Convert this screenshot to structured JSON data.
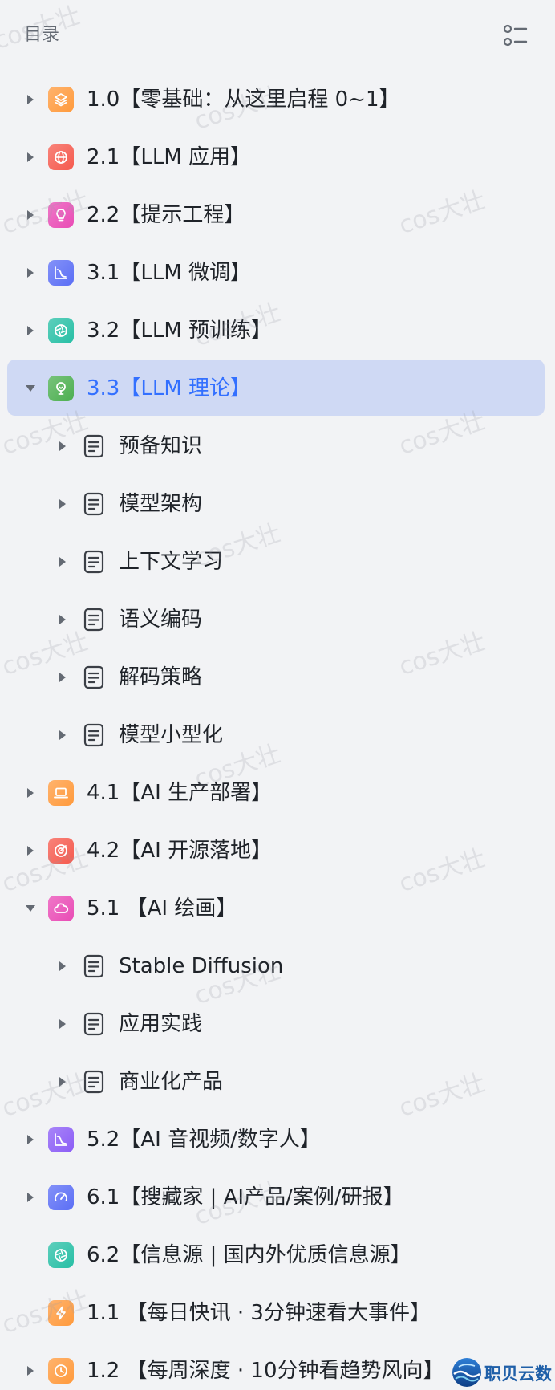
{
  "header": {
    "title": "目录",
    "toggle_icon": "outline-list-icon"
  },
  "watermark": "cos大壮",
  "colors": {
    "background": "#f2f3f5",
    "active_bg": "#cfd9f4",
    "active_text": "#3370ff",
    "text": "#1f2329",
    "muted": "#646a73"
  },
  "items": [
    {
      "label": "1.0【零基础：从这里启程 0~1】",
      "icon": "layers-icon",
      "color": "#ff9a3c",
      "expanded": false
    },
    {
      "label": "2.1【LLM 应用】",
      "icon": "globe-icon",
      "color": "#f55a4e",
      "expanded": false
    },
    {
      "label": "2.2【提示工程】",
      "icon": "lightbulb-icon",
      "color": "#e94bb5",
      "expanded": false
    },
    {
      "label": "3.1【LLM 微调】",
      "icon": "chart-icon",
      "color": "#5b6ef5",
      "expanded": false
    },
    {
      "label": "3.2【LLM 预训练】",
      "icon": "aperture-icon",
      "color": "#27bfa5",
      "expanded": false
    },
    {
      "label": "3.3【LLM 理论】",
      "icon": "bulb-idea-icon",
      "color": "#4caf50",
      "expanded": true,
      "active": true,
      "children": [
        "预备知识",
        "模型架构",
        "上下文学习",
        "语义编码",
        "解码策略",
        "模型小型化"
      ]
    },
    {
      "label": "4.1【AI 生产部署】",
      "icon": "laptop-icon",
      "color": "#ff9a3c",
      "expanded": false
    },
    {
      "label": "4.2【AI 开源落地】",
      "icon": "target-icon",
      "color": "#f55a4e",
      "expanded": false
    },
    {
      "label": "5.1 【AI 绘画】",
      "icon": "cloud-icon",
      "color": "#e94bb5",
      "expanded": true,
      "children": [
        "Stable Diffusion",
        "应用实践",
        "商业化产品"
      ]
    },
    {
      "label": "5.2【AI 音视频/数字人】",
      "icon": "chart-icon",
      "color": "#8b5cf6",
      "expanded": false
    },
    {
      "label": "6.1【搜藏家 | AI产品/案例/研报】",
      "icon": "gauge-icon",
      "color": "#5b6ef5",
      "expanded": false
    },
    {
      "label": "6.2【信息源 | 国内外优质信息源】",
      "icon": "aperture-icon",
      "color": "#27bfa5",
      "no_caret": true
    },
    {
      "label": "1.1 【每日快讯 · 3分钟速看大事件】",
      "icon": "lightning-icon",
      "color": "#ff9a3c",
      "no_caret": true
    },
    {
      "label": "1.2 【每周深度 · 10分钟看趋势风向】",
      "icon": "clock-icon",
      "color": "#ff9a3c",
      "expanded": false
    }
  ],
  "brand": {
    "name": "职贝云数",
    "logo_icon": "globe-wave-logo"
  }
}
